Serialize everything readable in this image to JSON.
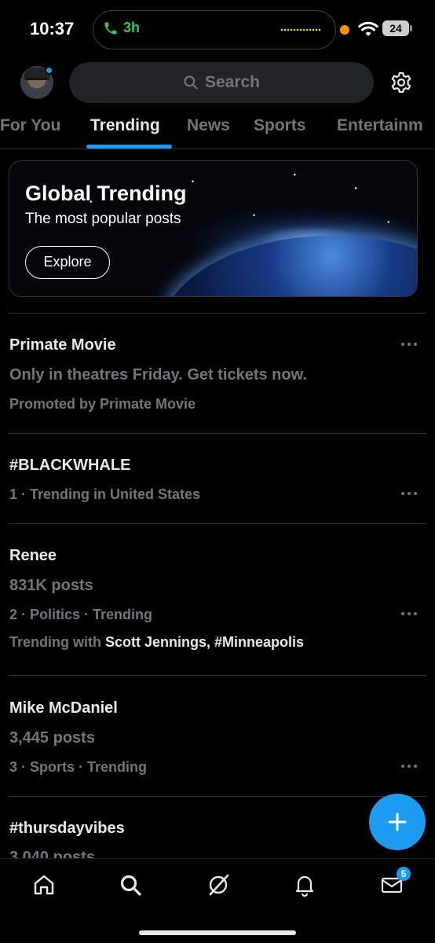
{
  "status_bar": {
    "time": "10:37",
    "call_duration": "3h",
    "battery": "24"
  },
  "header": {
    "search_placeholder": "Search"
  },
  "tabs": [
    {
      "label": "For You",
      "active": false
    },
    {
      "label": "Trending",
      "active": true
    },
    {
      "label": "News",
      "active": false
    },
    {
      "label": "Sports",
      "active": false
    },
    {
      "label": "Entertainm",
      "active": false
    }
  ],
  "banner": {
    "title": "Global Trending",
    "subtitle": "The most popular posts",
    "button": "Explore"
  },
  "trends": [
    {
      "title": "Primate Movie",
      "description": "Only in theatres Friday. Get tickets now.",
      "meta": "Promoted by Primate Movie"
    },
    {
      "title": "#BLACKWHALE",
      "meta": "1 · Trending in United States"
    },
    {
      "title": "Renee",
      "posts": "831K posts",
      "meta": "2 · Politics · Trending",
      "with_prefix": "Trending with",
      "with_names": "Scott Jennings, #Minneapolis"
    },
    {
      "title": "Mike McDaniel",
      "posts": "3,445 posts",
      "meta": "3 · Sports · Trending"
    },
    {
      "title": "#thursdayvibes",
      "posts": "3,040 posts"
    }
  ],
  "bottom_nav": {
    "messages_badge": "5"
  },
  "colors": {
    "accent": "#1d9bf0",
    "background": "#000000",
    "secondary_text": "#71767b",
    "call_green": "#34c759"
  }
}
